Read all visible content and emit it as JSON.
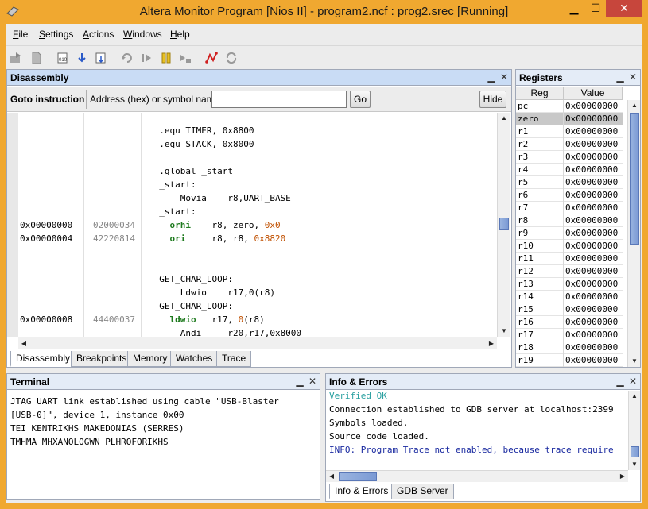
{
  "window": {
    "title": "Altera Monitor Program [Nios II] - program2.ncf : prog2.srec [Running]",
    "minimize": "▁",
    "maximize": "☐",
    "close": "✕"
  },
  "menu": [
    {
      "label_u": "F",
      "label_rest": "ile"
    },
    {
      "label_u": "S",
      "label_rest": "ettings"
    },
    {
      "label_u": "A",
      "label_rest": "ctions"
    },
    {
      "label_u": "W",
      "label_rest": "indows"
    },
    {
      "label_u": "H",
      "label_rest": "elp"
    }
  ],
  "disassembly": {
    "title": "Disassembly",
    "goto_label": "Goto instruction",
    "address_label": "Address (hex) or symbol name:",
    "address_value": "",
    "go_button": "Go",
    "hide_button": "Hide",
    "lines": [
      {
        "addr": "",
        "hex": "",
        "code": "  .equ TIMER, 0x8800"
      },
      {
        "addr": "",
        "hex": "",
        "code": "  .equ STACK, 0x8000"
      },
      {
        "addr": "",
        "hex": "",
        "code": ""
      },
      {
        "addr": "",
        "hex": "",
        "code": "  .global _start"
      },
      {
        "addr": "",
        "hex": "",
        "code": "  _start:"
      },
      {
        "addr": "",
        "hex": "",
        "code": "      Movia    r8,UART_BASE"
      },
      {
        "addr": "",
        "hex": "",
        "code": "  _start:"
      },
      {
        "addr": "0x00000000",
        "hex": "02000034",
        "mnemonic": "orhi",
        "operands": "r8, zero, ",
        "imm": "0x0"
      },
      {
        "addr": "0x00000004",
        "hex": "42220814",
        "mnemonic": "ori",
        "operands": "r8, r8, ",
        "imm": "0x8820"
      },
      {
        "addr": "",
        "hex": "",
        "code": ""
      },
      {
        "addr": "",
        "hex": "",
        "code": ""
      },
      {
        "addr": "",
        "hex": "",
        "code": "  GET_CHAR_LOOP:"
      },
      {
        "addr": "",
        "hex": "",
        "code": "      Ldwio    r17,0(r8)"
      },
      {
        "addr": "",
        "hex": "",
        "code": "  GET_CHAR_LOOP:"
      },
      {
        "addr": "0x00000008",
        "hex": "44400037",
        "mnemonic": "ldwio",
        "operands": "r17, ",
        "imm": "0",
        "tail": "(r8)"
      },
      {
        "addr": "",
        "hex": "",
        "code": "      Andi     r20,r17,0x8000"
      }
    ]
  },
  "bottom_tabs": [
    "Disassembly",
    "Breakpoints",
    "Memory",
    "Watches",
    "Trace"
  ],
  "registers": {
    "title": "Registers",
    "col_reg": "Reg",
    "col_value": "Value",
    "rows": [
      {
        "name": "pc",
        "value": "0x00000000"
      },
      {
        "name": "zero",
        "value": "0x00000000"
      },
      {
        "name": "r1",
        "value": "0x00000000"
      },
      {
        "name": "r2",
        "value": "0x00000000"
      },
      {
        "name": "r3",
        "value": "0x00000000"
      },
      {
        "name": "r4",
        "value": "0x00000000"
      },
      {
        "name": "r5",
        "value": "0x00000000"
      },
      {
        "name": "r6",
        "value": "0x00000000"
      },
      {
        "name": "r7",
        "value": "0x00000000"
      },
      {
        "name": "r8",
        "value": "0x00000000"
      },
      {
        "name": "r9",
        "value": "0x00000000"
      },
      {
        "name": "r10",
        "value": "0x00000000"
      },
      {
        "name": "r11",
        "value": "0x00000000"
      },
      {
        "name": "r12",
        "value": "0x00000000"
      },
      {
        "name": "r13",
        "value": "0x00000000"
      },
      {
        "name": "r14",
        "value": "0x00000000"
      },
      {
        "name": "r15",
        "value": "0x00000000"
      },
      {
        "name": "r16",
        "value": "0x00000000"
      },
      {
        "name": "r17",
        "value": "0x00000000"
      },
      {
        "name": "r18",
        "value": "0x00000000"
      },
      {
        "name": "r19",
        "value": "0x00000000"
      }
    ]
  },
  "terminal": {
    "title": "Terminal",
    "lines": [
      "JTAG UART link established using cable \"USB-Blaster",
      "[USB-0]\", device 1, instance 0x00",
      "TEI KENTRIKHS MAKEDONIAS (SERRES)",
      "TMHMA MHXANOLOGWN PLHROFORIKHS"
    ]
  },
  "info": {
    "title": "Info & Errors",
    "lines": [
      {
        "text": "Verified OK",
        "kind": "ok"
      },
      {
        "text": "Connection established to GDB server at localhost:2399",
        "kind": "normal"
      },
      {
        "text": "Symbols loaded.",
        "kind": "normal"
      },
      {
        "text": "Source code loaded.",
        "kind": "normal"
      },
      {
        "text": "INFO: Program Trace not enabled, because trace require",
        "kind": "info"
      }
    ],
    "tabs": [
      "Info & Errors",
      "GDB Server"
    ]
  },
  "colors": {
    "titlebar": "#f0a830",
    "panel_header": "#c9dcf5",
    "close_button": "#c7463c",
    "keyword": "#1e7a1e",
    "immediate": "#c05000"
  },
  "icons": [
    "load-icon",
    "file-icon",
    "compile-icon",
    "download-icon",
    "compile-load-icon",
    "restart-icon",
    "continue-icon",
    "pause-icon",
    "step-icon",
    "breakpoint-icon",
    "refresh-icon"
  ]
}
